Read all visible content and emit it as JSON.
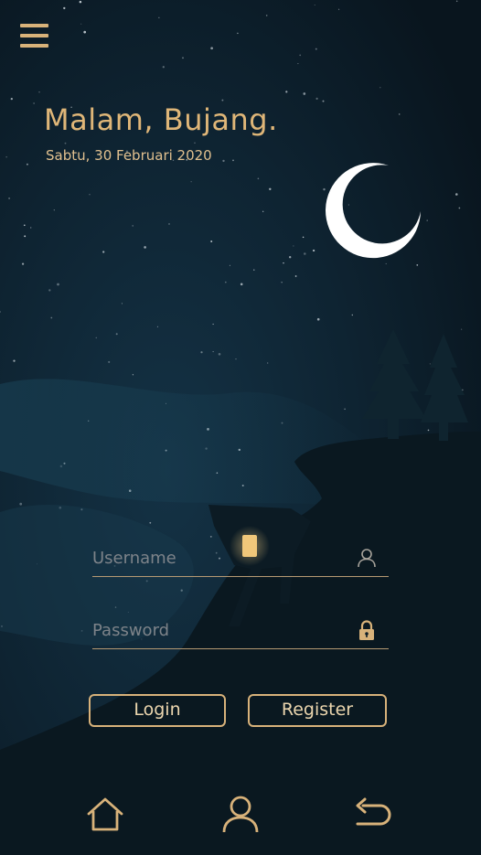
{
  "header": {
    "greeting": "Malam, Bujang.",
    "date": "Sabtu, 30 Februari 2020"
  },
  "menu_icon": "hamburger-menu-icon",
  "scene": {
    "moon_icon": "crescent-moon-icon",
    "sky_color": "#0c1a25",
    "accent": "#d8b27a"
  },
  "login_form": {
    "username": {
      "value": "",
      "placeholder": "Username",
      "icon": "user-icon"
    },
    "password": {
      "value": "",
      "placeholder": "Password",
      "icon": "lock-icon"
    },
    "login_label": "Login",
    "register_label": "Register"
  },
  "bottom_nav": [
    {
      "icon": "home-icon"
    },
    {
      "icon": "profile-icon"
    },
    {
      "icon": "back-icon"
    }
  ]
}
